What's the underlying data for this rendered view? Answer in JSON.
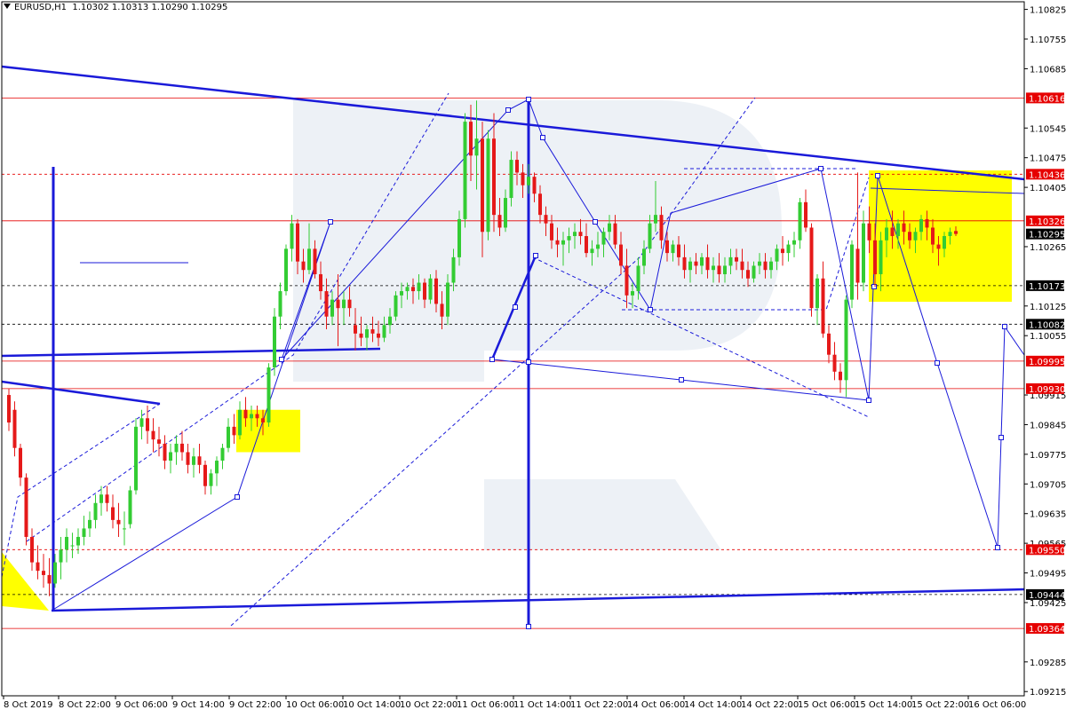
{
  "header": {
    "symbol": "EURUSD,H1",
    "ohlc": "1.10302 1.10313 1.10290 1.10295"
  },
  "colors": {
    "bull": "#33cc33",
    "bear": "#e51919",
    "levels_red": "#e60000",
    "trend_blue": "#1a1ad9",
    "highlight_yellow": "#ffff00",
    "watermark": "#e7ecf4"
  },
  "chart_data": {
    "type": "candlestick",
    "title": "EURUSD,H1",
    "ylim": [
      1.09205,
      1.10843
    ],
    "y_ticks": [
      "1.10825",
      "1.10755",
      "1.10685",
      "1.10545",
      "1.10475",
      "1.10405",
      "1.10265",
      "1.10125",
      "1.10055",
      "1.09915",
      "1.09845",
      "1.09775",
      "1.09705",
      "1.09635",
      "1.09565",
      "1.09495",
      "1.09425",
      "1.09285",
      "1.09215"
    ],
    "x_ticks": [
      "8 Oct 2019",
      "8 Oct 22:00",
      "9 Oct 06:00",
      "9 Oct 14:00",
      "9 Oct 22:00",
      "10 Oct 06:00",
      "10 Oct 14:00",
      "10 Oct 22:00",
      "11 Oct 06:00",
      "11 Oct 14:00",
      "11 Oct 22:00",
      "14 Oct 06:00",
      "14 Oct 14:00",
      "14 Oct 22:00",
      "15 Oct 06:00",
      "15 Oct 14:00",
      "15 Oct 22:00",
      "16 Oct 06:00"
    ],
    "levels": [
      {
        "label": "1.10616",
        "value": 1.10616,
        "style": "solid",
        "color": "red"
      },
      {
        "label": "1.10436",
        "value": 1.10436,
        "style": "dashed",
        "color": "red"
      },
      {
        "label": "1.10326",
        "value": 1.10326,
        "style": "solid",
        "color": "red"
      },
      {
        "label": "1.10295",
        "value": 1.10295,
        "style": "current",
        "color": "black"
      },
      {
        "label": "1.10173",
        "value": 1.10173,
        "style": "dashed",
        "color": "black"
      },
      {
        "label": "1.10082",
        "value": 1.10082,
        "style": "dashed",
        "color": "black"
      },
      {
        "label": "1.09995",
        "value": 1.09995,
        "style": "solid",
        "color": "red"
      },
      {
        "label": "1.09930",
        "value": 1.0993,
        "style": "solid",
        "color": "red"
      },
      {
        "label": "1.09550",
        "value": 1.0955,
        "style": "dashed",
        "color": "red"
      },
      {
        "label": "1.09444",
        "value": 1.09444,
        "style": "dashed",
        "color": "black"
      },
      {
        "label": "1.09364",
        "value": 1.09364,
        "style": "solid",
        "color": "red"
      }
    ],
    "candles": [
      [
        1.09915,
        1.0993,
        1.0983,
        1.0985
      ],
      [
        1.0988,
        1.099,
        1.0977,
        1.0979
      ],
      [
        1.0979,
        1.098,
        1.097,
        1.0972
      ],
      [
        1.0972,
        1.0973,
        1.0956,
        1.0958
      ],
      [
        1.0958,
        1.096,
        1.095,
        1.0952
      ],
      [
        1.0952,
        1.0956,
        1.0948,
        1.095
      ],
      [
        1.095,
        1.0954,
        1.0946,
        1.0949
      ],
      [
        1.0949,
        1.0953,
        1.0944,
        1.0947
      ],
      [
        1.0947,
        1.0954,
        1.0946,
        1.0952
      ],
      [
        1.0952,
        1.0958,
        1.0948,
        1.0955
      ],
      [
        1.0955,
        1.096,
        1.0952,
        1.0958
      ],
      [
        1.0956,
        1.0959,
        1.0953,
        1.0956
      ],
      [
        1.0956,
        1.096,
        1.0954,
        1.0958
      ],
      [
        1.0958,
        1.0963,
        1.0956,
        1.096
      ],
      [
        1.096,
        1.0964,
        1.0958,
        1.0962
      ],
      [
        1.0962,
        1.0968,
        1.096,
        1.0966
      ],
      [
        1.0966,
        1.097,
        1.0963,
        1.0968
      ],
      [
        1.0968,
        1.097,
        1.0964,
        1.0966
      ],
      [
        1.0965,
        1.0968,
        1.096,
        1.0962
      ],
      [
        1.0962,
        1.0966,
        1.0958,
        1.0961
      ],
      [
        1.096,
        1.0964,
        1.0956,
        1.096
      ],
      [
        1.0961,
        1.097,
        1.096,
        1.0969
      ],
      [
        1.0969,
        1.0986,
        1.0968,
        1.0984
      ],
      [
        1.0984,
        1.0988,
        1.0981,
        1.0986
      ],
      [
        1.0986,
        1.0989,
        1.098,
        1.0983
      ],
      [
        1.0983,
        1.0986,
        1.0978,
        1.0981
      ],
      [
        1.0981,
        1.0984,
        1.0977,
        1.098
      ],
      [
        1.098,
        1.0982,
        1.0974,
        1.0976
      ],
      [
        1.0976,
        1.098,
        1.0973,
        1.0978
      ],
      [
        1.0978,
        1.0982,
        1.0975,
        1.098
      ],
      [
        1.098,
        1.0983,
        1.0976,
        1.0978
      ],
      [
        1.0978,
        1.098,
        1.0973,
        1.0975
      ],
      [
        1.0975,
        1.0979,
        1.0972,
        1.0977
      ],
      [
        1.0977,
        1.098,
        1.0973,
        1.0975
      ],
      [
        1.0975,
        1.0976,
        1.0968,
        1.097
      ],
      [
        1.097,
        1.0974,
        1.0968,
        1.0973
      ],
      [
        1.0973,
        1.0977,
        1.097,
        1.0976
      ],
      [
        1.0976,
        1.098,
        1.0974,
        1.0979
      ],
      [
        1.0979,
        1.0986,
        1.0978,
        1.0984
      ],
      [
        1.0984,
        1.0987,
        1.098,
        1.0982
      ],
      [
        1.0982,
        1.099,
        1.0981,
        1.0988
      ],
      [
        1.0988,
        1.0991,
        1.0984,
        1.0986
      ],
      [
        1.0986,
        1.0989,
        1.0983,
        1.0987
      ],
      [
        1.0987,
        1.0989,
        1.0984,
        1.0986
      ],
      [
        1.0986,
        1.0988,
        1.0982,
        1.0985
      ],
      [
        1.0985,
        1.0999,
        1.0984,
        1.0998
      ],
      [
        1.0998,
        1.1012,
        1.0996,
        1.101
      ],
      [
        1.101,
        1.1018,
        1.1007,
        1.1016
      ],
      [
        1.1016,
        1.1027,
        1.1015,
        1.1026
      ],
      [
        1.1026,
        1.1034,
        1.1023,
        1.1032
      ],
      [
        1.1032,
        1.1033,
        1.102,
        1.1023
      ],
      [
        1.1023,
        1.1026,
        1.1018,
        1.1021
      ],
      [
        1.1021,
        1.1032,
        1.102,
        1.1026
      ],
      [
        1.1026,
        1.1028,
        1.1019,
        1.102
      ],
      [
        1.102,
        1.1023,
        1.1014,
        1.1016
      ],
      [
        1.1016,
        1.1019,
        1.1007,
        1.101
      ],
      [
        1.101,
        1.1016,
        1.1008,
        1.1014
      ],
      [
        1.1014,
        1.102,
        1.1003,
        1.1012
      ],
      [
        1.1012,
        1.1016,
        1.1008,
        1.1014
      ],
      [
        1.1014,
        1.1017,
        1.101,
        1.1012
      ],
      [
        1.1008,
        1.1012,
        1.1002,
        1.1006
      ],
      [
        1.1006,
        1.101,
        1.1003,
        1.1005
      ],
      [
        1.1005,
        1.1008,
        1.1002,
        1.1007
      ],
      [
        1.1007,
        1.101,
        1.1004,
        1.1006
      ],
      [
        1.1006,
        1.1009,
        1.1003,
        1.1005
      ],
      [
        1.1005,
        1.101,
        1.1004,
        1.1008
      ],
      [
        1.1008,
        1.1012,
        1.1006,
        1.101
      ],
      [
        1.101,
        1.1016,
        1.1009,
        1.1015
      ],
      [
        1.1015,
        1.1018,
        1.1012,
        1.1016
      ],
      [
        1.1016,
        1.1018,
        1.1014,
        1.1017
      ],
      [
        1.1017,
        1.1019,
        1.1013,
        1.1016
      ],
      [
        1.1016,
        1.102,
        1.1014,
        1.1018
      ],
      [
        1.1018,
        1.1019,
        1.1012,
        1.1014
      ],
      [
        1.1014,
        1.102,
        1.1013,
        1.1019
      ],
      [
        1.1019,
        1.1021,
        1.1011,
        1.1013
      ],
      [
        1.1013,
        1.1016,
        1.1007,
        1.101
      ],
      [
        1.101,
        1.102,
        1.1008,
        1.1018
      ],
      [
        1.1018,
        1.1026,
        1.1016,
        1.1024
      ],
      [
        1.1024,
        1.1035,
        1.1022,
        1.1033
      ],
      [
        1.1033,
        1.1058,
        1.1031,
        1.1056
      ],
      [
        1.1056,
        1.106,
        1.1042,
        1.1048
      ],
      [
        1.1048,
        1.1061,
        1.104,
        1.1052
      ],
      [
        1.1052,
        1.1056,
        1.1024,
        1.103
      ],
      [
        1.103,
        1.1054,
        1.1028,
        1.1052
      ],
      [
        1.1052,
        1.1058,
        1.103,
        1.1034
      ],
      [
        1.1034,
        1.1038,
        1.1029,
        1.1031
      ],
      [
        1.1031,
        1.104,
        1.103,
        1.1038
      ],
      [
        1.1038,
        1.1049,
        1.1036,
        1.1047
      ],
      [
        1.1047,
        1.1049,
        1.1041,
        1.1044
      ],
      [
        1.1044,
        1.1046,
        1.1038,
        1.1041
      ],
      [
        1.1041,
        1.1046,
        1.1039,
        1.1043
      ],
      [
        1.1043,
        1.1044,
        1.1037,
        1.1039
      ],
      [
        1.1039,
        1.1041,
        1.1032,
        1.1034
      ],
      [
        1.1034,
        1.1036,
        1.1029,
        1.1032
      ],
      [
        1.1032,
        1.1034,
        1.1026,
        1.1028
      ],
      [
        1.1028,
        1.1031,
        1.1024,
        1.1027
      ],
      [
        1.1027,
        1.103,
        1.1022,
        1.1028
      ],
      [
        1.1028,
        1.1031,
        1.1025,
        1.1029
      ],
      [
        1.1029,
        1.1032,
        1.1026,
        1.103
      ],
      [
        1.103,
        1.1033,
        1.1027,
        1.1029
      ],
      [
        1.1029,
        1.1032,
        1.1024,
        1.1025
      ],
      [
        1.1025,
        1.1028,
        1.1022,
        1.1026
      ],
      [
        1.1026,
        1.103,
        1.1024,
        1.1027
      ],
      [
        1.1027,
        1.1031,
        1.1024,
        1.103
      ],
      [
        1.103,
        1.1034,
        1.1028,
        1.1032
      ],
      [
        1.1032,
        1.1034,
        1.1026,
        1.1027
      ],
      [
        1.1027,
        1.103,
        1.102,
        1.1022
      ],
      [
        1.1022,
        1.1026,
        1.1012,
        1.1015
      ],
      [
        1.1015,
        1.1018,
        1.1012,
        1.1016
      ],
      [
        1.1016,
        1.1024,
        1.1014,
        1.1022
      ],
      [
        1.1022,
        1.1028,
        1.102,
        1.1026
      ],
      [
        1.1026,
        1.1034,
        1.1025,
        1.1032
      ],
      [
        1.1032,
        1.1042,
        1.103,
        1.1034
      ],
      [
        1.1034,
        1.1036,
        1.1026,
        1.1028
      ],
      [
        1.1028,
        1.103,
        1.1023,
        1.1025
      ],
      [
        1.1025,
        1.1028,
        1.1023,
        1.1027
      ],
      [
        1.1027,
        1.1029,
        1.1022,
        1.1024
      ],
      [
        1.1024,
        1.1027,
        1.1019,
        1.1021
      ],
      [
        1.1021,
        1.1024,
        1.1018,
        1.1023
      ],
      [
        1.1023,
        1.1025,
        1.102,
        1.1022
      ],
      [
        1.1022,
        1.1025,
        1.102,
        1.1024
      ],
      [
        1.1024,
        1.1027,
        1.1019,
        1.1021
      ],
      [
        1.1021,
        1.1024,
        1.1018,
        1.1022
      ],
      [
        1.1022,
        1.1025,
        1.1018,
        1.102
      ],
      [
        1.102,
        1.1024,
        1.1018,
        1.1022
      ],
      [
        1.1022,
        1.1026,
        1.102,
        1.1024
      ],
      [
        1.1024,
        1.1026,
        1.1021,
        1.1023
      ],
      [
        1.1023,
        1.1026,
        1.1019,
        1.1021
      ],
      [
        1.1021,
        1.1023,
        1.1017,
        1.1019
      ],
      [
        1.1019,
        1.1023,
        1.1018,
        1.1022
      ],
      [
        1.1022,
        1.1025,
        1.102,
        1.1023
      ],
      [
        1.1023,
        1.1025,
        1.1019,
        1.1021
      ],
      [
        1.1021,
        1.1024,
        1.1019,
        1.1023
      ],
      [
        1.1023,
        1.1027,
        1.1021,
        1.1026
      ],
      [
        1.1026,
        1.1029,
        1.1022,
        1.1025
      ],
      [
        1.1025,
        1.1028,
        1.1023,
        1.1027
      ],
      [
        1.1027,
        1.103,
        1.1024,
        1.1028
      ],
      [
        1.1028,
        1.1038,
        1.1026,
        1.1037
      ],
      [
        1.1037,
        1.104,
        1.103,
        1.1031
      ],
      [
        1.1031,
        1.1032,
        1.101,
        1.1012
      ],
      [
        1.1012,
        1.102,
        1.1008,
        1.1019
      ],
      [
        1.1019,
        1.1023,
        1.1005,
        1.1006
      ],
      [
        1.1006,
        1.1008,
        1.0999,
        1.1001
      ],
      [
        1.1001,
        1.1004,
        1.0995,
        1.0997
      ],
      [
        1.0997,
        1.0999,
        1.0992,
        1.0995
      ],
      [
        1.0995,
        1.1015,
        1.0991,
        1.1014
      ],
      [
        1.1014,
        1.1028,
        1.1012,
        1.1027
      ],
      [
        1.1026,
        1.1044,
        1.1014,
        1.1018
      ],
      [
        1.1018,
        1.1035,
        1.1016,
        1.1032
      ],
      [
        1.1032,
        1.1036,
        1.1025,
        1.1028
      ],
      [
        1.1028,
        1.1032,
        1.1017,
        1.102
      ],
      [
        1.102,
        1.103,
        1.1016,
        1.1028
      ],
      [
        1.1028,
        1.1033,
        1.1024,
        1.1031
      ],
      [
        1.1031,
        1.1035,
        1.1026,
        1.1029
      ],
      [
        1.1029,
        1.1033,
        1.1026,
        1.1032
      ],
      [
        1.1032,
        1.1035,
        1.1027,
        1.103
      ],
      [
        1.103,
        1.1032,
        1.1026,
        1.1028
      ],
      [
        1.1028,
        1.1031,
        1.1025,
        1.103
      ],
      [
        1.103,
        1.1034,
        1.1028,
        1.1033
      ],
      [
        1.1033,
        1.1035,
        1.1028,
        1.1031
      ],
      [
        1.1031,
        1.1033,
        1.1025,
        1.1027
      ],
      [
        1.1027,
        1.1029,
        1.1022,
        1.1026
      ],
      [
        1.1026,
        1.103,
        1.1024,
        1.1029
      ],
      [
        1.1029,
        1.1031,
        1.1027,
        1.103
      ],
      [
        1.10302,
        1.10313,
        1.1029,
        1.10295
      ]
    ]
  }
}
